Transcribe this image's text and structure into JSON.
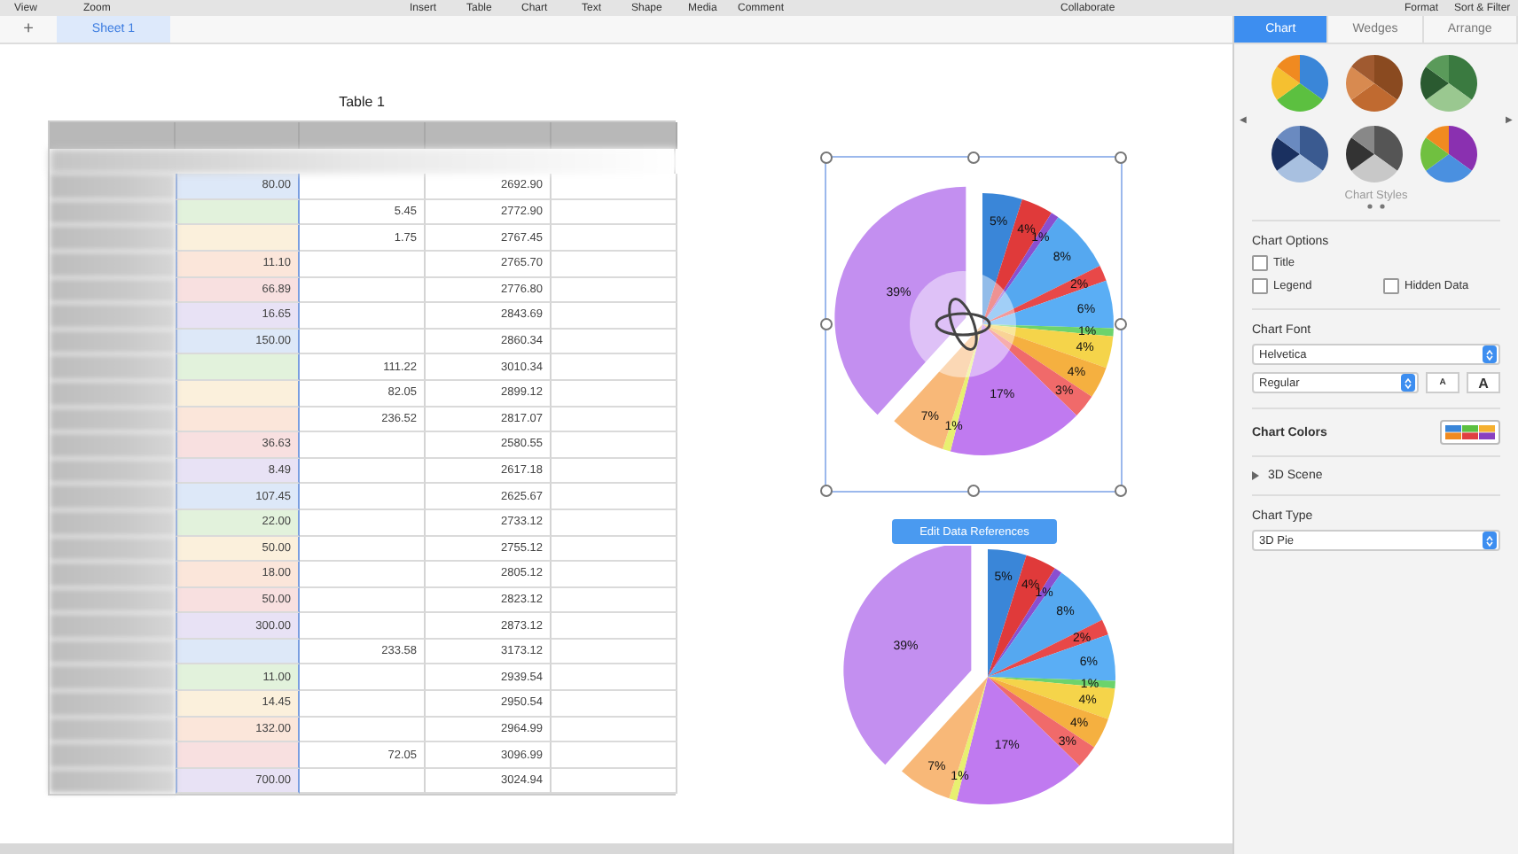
{
  "menu_bar": {
    "items": [
      "View",
      "Zoom",
      "Insert",
      "Table",
      "Chart",
      "Text",
      "Shape",
      "Media",
      "Comment",
      "Collaborate",
      "Format",
      "Sort & Filter"
    ]
  },
  "sheet_tabs": {
    "add": "+",
    "tabs": [
      {
        "label": "Sheet 1",
        "selected": true
      }
    ]
  },
  "table": {
    "title": "Table 1",
    "rows": [
      {
        "color": "#dde8f8",
        "b": "80.00",
        "c": "",
        "d": "2692.90"
      },
      {
        "color": "#e2f2dc",
        "b": "",
        "c": "5.45",
        "d": "2772.90"
      },
      {
        "color": "#fbf0dc",
        "b": "",
        "c": "1.75",
        "d": "2767.45"
      },
      {
        "color": "#fbe6da",
        "b": "11.10",
        "c": "",
        "d": "2765.70"
      },
      {
        "color": "#f8e0e0",
        "b": "66.89",
        "c": "",
        "d": "2776.80"
      },
      {
        "color": "#e8e2f5",
        "b": "16.65",
        "c": "",
        "d": "2843.69"
      },
      {
        "color": "#dde8f8",
        "b": "150.00",
        "c": "",
        "d": "2860.34"
      },
      {
        "color": "#e2f2dc",
        "b": "",
        "c": "111.22",
        "d": "3010.34"
      },
      {
        "color": "#fbf0dc",
        "b": "",
        "c": "82.05",
        "d": "2899.12"
      },
      {
        "color": "#fbe6da",
        "b": "",
        "c": "236.52",
        "d": "2817.07"
      },
      {
        "color": "#f8e0e0",
        "b": "36.63",
        "c": "",
        "d": "2580.55"
      },
      {
        "color": "#e8e2f5",
        "b": "8.49",
        "c": "",
        "d": "2617.18"
      },
      {
        "color": "#dde8f8",
        "b": "107.45",
        "c": "",
        "d": "2625.67"
      },
      {
        "color": "#e2f2dc",
        "b": "22.00",
        "c": "",
        "d": "2733.12"
      },
      {
        "color": "#fbf0dc",
        "b": "50.00",
        "c": "",
        "d": "2755.12"
      },
      {
        "color": "#fbe6da",
        "b": "18.00",
        "c": "",
        "d": "2805.12"
      },
      {
        "color": "#f8e0e0",
        "b": "50.00",
        "c": "",
        "d": "2823.12"
      },
      {
        "color": "#e8e2f5",
        "b": "300.00",
        "c": "",
        "d": "2873.12"
      },
      {
        "color": "#dde8f8",
        "b": "",
        "c": "233.58",
        "d": "3173.12"
      },
      {
        "color": "#e2f2dc",
        "b": "11.00",
        "c": "",
        "d": "2939.54"
      },
      {
        "color": "#fbf0dc",
        "b": "14.45",
        "c": "",
        "d": "2950.54"
      },
      {
        "color": "#fbe6da",
        "b": "132.00",
        "c": "",
        "d": "2964.99"
      },
      {
        "color": "#f8e0e0",
        "b": "",
        "c": "72.05",
        "d": "3096.99"
      },
      {
        "color": "#e8e2f5",
        "b": "700.00",
        "c": "",
        "d": "3024.94"
      }
    ]
  },
  "chart_selected": {
    "chart_data": {
      "type": "pie",
      "values": [
        5,
        4,
        1,
        8,
        2,
        6,
        1,
        4,
        4,
        3,
        17,
        1,
        7,
        39
      ],
      "value_labels": [
        "5%",
        "4%",
        "1%",
        "8%",
        "2%",
        "6%",
        "1%",
        "4%",
        "4%",
        "3%",
        "17%",
        "1%",
        "7%",
        "39%"
      ]
    }
  },
  "edit_button": {
    "label": "Edit Data References"
  },
  "chart_preview": {
    "chart_data": {
      "type": "pie",
      "values": [
        5,
        4,
        1,
        8,
        2,
        6,
        1,
        4,
        4,
        3,
        17,
        1,
        7,
        39
      ],
      "value_labels": [
        "5%",
        "4%",
        "1%",
        "8%",
        "2%",
        "6%",
        "1%",
        "4%",
        "4%",
        "3%",
        "17%",
        "1%",
        "7%",
        "39%"
      ]
    }
  },
  "inspector": {
    "tabs": [
      {
        "label": "Chart",
        "selected": true
      },
      {
        "label": "Wedges",
        "selected": false
      },
      {
        "label": "Arrange",
        "selected": false
      }
    ],
    "styles": [
      {
        "kind": "bright"
      },
      {
        "kind": "wood"
      },
      {
        "kind": "green"
      },
      {
        "kind": "blue"
      },
      {
        "kind": "gray"
      },
      {
        "kind": "vivid"
      }
    ],
    "styles_prev": "◀",
    "styles_next": "▶",
    "styles_label": "Chart Styles",
    "options_title": "Chart Options",
    "options": [
      {
        "label": "Title",
        "checked": false
      },
      {
        "label": "Legend",
        "checked": false
      },
      {
        "label": "Hidden Data",
        "checked": false
      }
    ],
    "font_title": "Chart Font",
    "font": "Helvetica",
    "weight": "Regular",
    "size_buttons": [
      "A",
      "A"
    ],
    "colors_title": "Chart Colors",
    "scene": {
      "label": "3D Scene",
      "expanded": false
    },
    "type_title": "Chart Type",
    "type": "3D Pie"
  }
}
